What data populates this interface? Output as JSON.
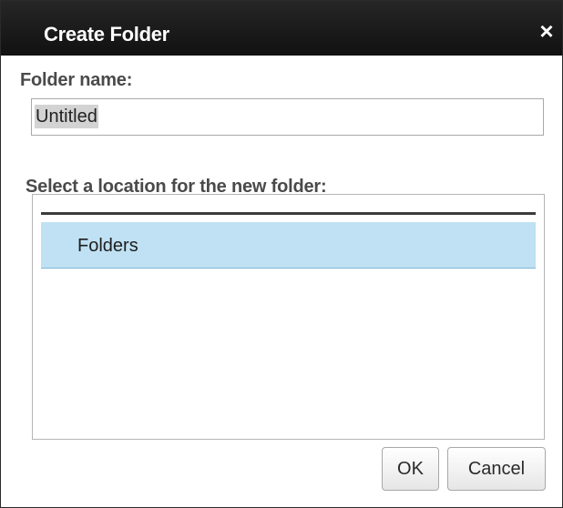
{
  "dialog": {
    "title": "Create Folder",
    "close_glyph": "×",
    "close_icon": "close-icon"
  },
  "name_field": {
    "label": "Folder name:",
    "value": "Untitled"
  },
  "location": {
    "label": "Select a location for the new folder:",
    "items": [
      {
        "label": "Folders",
        "selected": true
      }
    ]
  },
  "buttons": {
    "ok_label": "OK",
    "cancel_label": "Cancel"
  },
  "colors": {
    "titlebar": "#1a1a1a",
    "selection_row": "#bfe1f3"
  }
}
